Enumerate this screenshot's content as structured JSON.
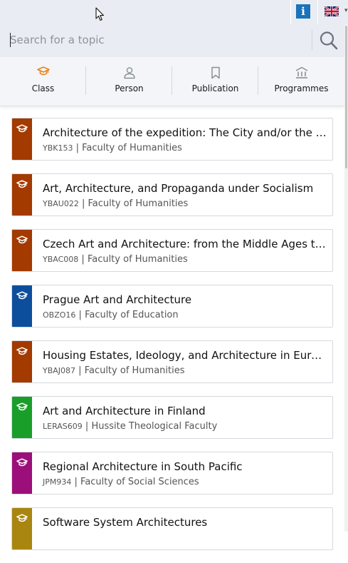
{
  "header": {
    "info_label": "i",
    "flag_name": "uk-flag-icon"
  },
  "search": {
    "placeholder": "Search for a topic",
    "value": ""
  },
  "tabs": [
    {
      "label": "Class",
      "icon": "graduation-cap-icon",
      "active": true
    },
    {
      "label": "Person",
      "icon": "person-icon",
      "active": false
    },
    {
      "label": "Publication",
      "icon": "bookmark-icon",
      "active": false
    },
    {
      "label": "Programmes",
      "icon": "institution-icon",
      "active": false
    }
  ],
  "colors": {
    "accent": "#e8831a",
    "humanities": "#a33a00",
    "education": "#0d4e9c",
    "hussite": "#1a9e2a",
    "social_sciences": "#9c0f7a",
    "other": "#a8860f"
  },
  "results": [
    {
      "title": "Architecture of the expedition: The City and/or the Ruin",
      "code": "YBK153",
      "faculty": "Faculty of Humanities",
      "color": "#a33a00"
    },
    {
      "title": "Art, Architecture, and Propaganda under Socialism",
      "code": "YBAU022",
      "faculty": "Faculty of Humanities",
      "color": "#a33a00"
    },
    {
      "title": "Czech Art and Architecture: from the Middle Ages to the Present",
      "code": "YBAC008",
      "faculty": "Faculty of Humanities",
      "color": "#a33a00"
    },
    {
      "title": "Prague Art and Architecture",
      "code": "OBZO16",
      "faculty": "Faculty of Education",
      "color": "#0d4e9c"
    },
    {
      "title": "Housing Estates, Ideology, and Architecture in Europe",
      "code": "YBAJ087",
      "faculty": "Faculty of Humanities",
      "color": "#a33a00"
    },
    {
      "title": "Art and Architecture in Finland",
      "code": "LERAS609",
      "faculty": "Hussite Theological Faculty",
      "color": "#1a9e2a"
    },
    {
      "title": "Regional Architecture in South Pacific",
      "code": "JPM934",
      "faculty": "Faculty of Social Sciences",
      "color": "#9c0f7a"
    },
    {
      "title": "Software System Architectures",
      "code": "",
      "faculty": "",
      "color": "#a8860f"
    }
  ]
}
